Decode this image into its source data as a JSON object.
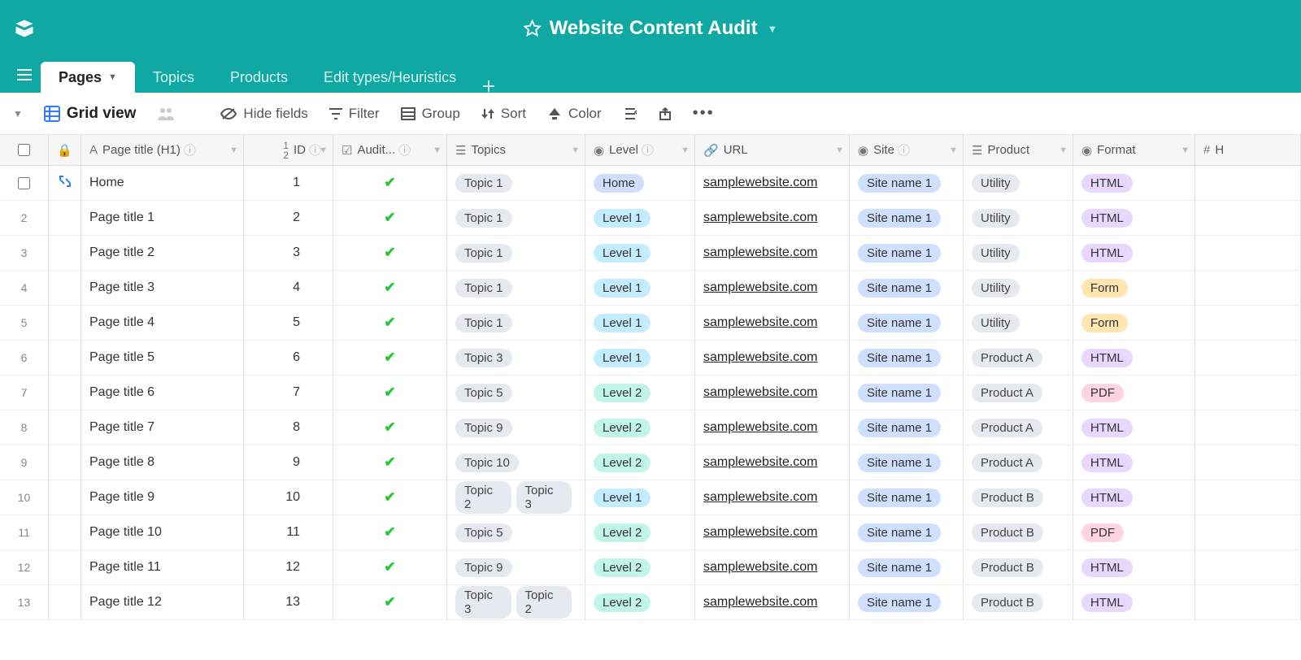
{
  "header": {
    "title": "Website Content Audit"
  },
  "tabs": [
    {
      "label": "Pages",
      "active": true,
      "hasCaret": true
    },
    {
      "label": "Topics",
      "active": false
    },
    {
      "label": "Products",
      "active": false
    },
    {
      "label": "Edit types/Heuristics",
      "active": false
    }
  ],
  "viewbar": {
    "viewName": "Grid view",
    "hideFields": "Hide fields",
    "filter": "Filter",
    "group": "Group",
    "sort": "Sort",
    "color": "Color"
  },
  "columns": {
    "pageTitle": "Page title (H1)",
    "id": "ID",
    "audit": "Audit...",
    "topics": "Topics",
    "level": "Level",
    "url": "URL",
    "site": "Site",
    "product": "Product",
    "format": "Format",
    "last": "H"
  },
  "pillColors": {
    "topic": "gray",
    "level_home": "home",
    "level_1": "cyan",
    "level_2": "teal",
    "site": "blue",
    "product": "gray",
    "format_html": "lav",
    "format_form": "yellow",
    "format_pdf": "pink"
  },
  "rows": [
    {
      "num": "",
      "expand": true,
      "title": "Home",
      "id": "1",
      "audit": true,
      "topics": [
        "Topic 1"
      ],
      "level": "Home",
      "levelClass": "home",
      "url": "samplewebsite.com",
      "site": "Site name 1",
      "product": "Utility",
      "format": "HTML",
      "formatClass": "lav"
    },
    {
      "num": "2",
      "title": "Page title 1",
      "id": "2",
      "audit": true,
      "topics": [
        "Topic 1"
      ],
      "level": "Level 1",
      "levelClass": "cyan",
      "url": "samplewebsite.com",
      "site": "Site name 1",
      "product": "Utility",
      "format": "HTML",
      "formatClass": "lav"
    },
    {
      "num": "3",
      "title": "Page title 2",
      "id": "3",
      "audit": true,
      "topics": [
        "Topic 1"
      ],
      "level": "Level 1",
      "levelClass": "cyan",
      "url": "samplewebsite.com",
      "site": "Site name 1",
      "product": "Utility",
      "format": "HTML",
      "formatClass": "lav"
    },
    {
      "num": "4",
      "title": "Page title 3",
      "id": "4",
      "audit": true,
      "topics": [
        "Topic 1"
      ],
      "level": "Level 1",
      "levelClass": "cyan",
      "url": "samplewebsite.com",
      "site": "Site name 1",
      "product": "Utility",
      "format": "Form",
      "formatClass": "yellow"
    },
    {
      "num": "5",
      "title": "Page title 4",
      "id": "5",
      "audit": true,
      "topics": [
        "Topic 1"
      ],
      "level": "Level 1",
      "levelClass": "cyan",
      "url": "samplewebsite.com",
      "site": "Site name 1",
      "product": "Utility",
      "format": "Form",
      "formatClass": "yellow"
    },
    {
      "num": "6",
      "title": "Page title 5",
      "id": "6",
      "audit": true,
      "topics": [
        "Topic 3"
      ],
      "level": "Level 1",
      "levelClass": "cyan",
      "url": "samplewebsite.com",
      "site": "Site name 1",
      "product": "Product A",
      "format": "HTML",
      "formatClass": "lav"
    },
    {
      "num": "7",
      "title": "Page title 6",
      "id": "7",
      "audit": true,
      "topics": [
        "Topic 5"
      ],
      "level": "Level 2",
      "levelClass": "teal",
      "url": "samplewebsite.com",
      "site": "Site name 1",
      "product": "Product A",
      "format": "PDF",
      "formatClass": "pink"
    },
    {
      "num": "8",
      "title": "Page title 7",
      "id": "8",
      "audit": true,
      "topics": [
        "Topic 9"
      ],
      "level": "Level 2",
      "levelClass": "teal",
      "url": "samplewebsite.com",
      "site": "Site name 1",
      "product": "Product A",
      "format": "HTML",
      "formatClass": "lav"
    },
    {
      "num": "9",
      "title": "Page title 8",
      "id": "9",
      "audit": true,
      "topics": [
        "Topic 10"
      ],
      "level": "Level 2",
      "levelClass": "teal",
      "url": "samplewebsite.com",
      "site": "Site name 1",
      "product": "Product A",
      "format": "HTML",
      "formatClass": "lav"
    },
    {
      "num": "10",
      "title": "Page title 9",
      "id": "10",
      "audit": true,
      "topics": [
        "Topic 2",
        "Topic 3"
      ],
      "level": "Level 1",
      "levelClass": "cyan",
      "url": "samplewebsite.com",
      "site": "Site name 1",
      "product": "Product B",
      "format": "HTML",
      "formatClass": "lav"
    },
    {
      "num": "11",
      "title": "Page title 10",
      "id": "11",
      "audit": true,
      "topics": [
        "Topic 5"
      ],
      "level": "Level 2",
      "levelClass": "teal",
      "url": "samplewebsite.com",
      "site": "Site name 1",
      "product": "Product B",
      "format": "PDF",
      "formatClass": "pink"
    },
    {
      "num": "12",
      "title": "Page title 11",
      "id": "12",
      "audit": true,
      "topics": [
        "Topic 9"
      ],
      "level": "Level 2",
      "levelClass": "teal",
      "url": "samplewebsite.com",
      "site": "Site name 1",
      "product": "Product B",
      "format": "HTML",
      "formatClass": "lav"
    },
    {
      "num": "13",
      "title": "Page title 12",
      "id": "13",
      "audit": true,
      "topics": [
        "Topic 3",
        "Topic 2"
      ],
      "level": "Level 2",
      "levelClass": "teal",
      "url": "samplewebsite.com",
      "site": "Site name 1",
      "product": "Product B",
      "format": "HTML",
      "formatClass": "lav"
    }
  ]
}
